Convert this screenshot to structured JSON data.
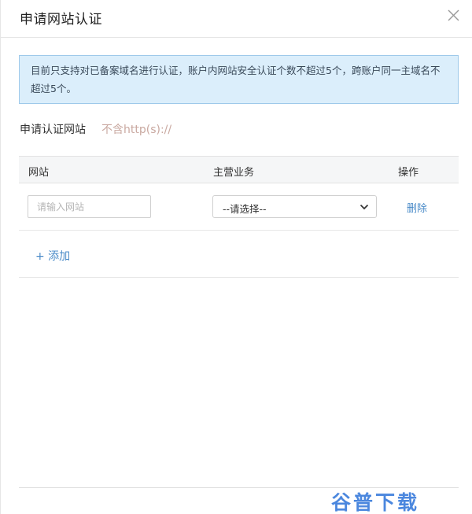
{
  "dialog": {
    "title": "申请网站认证",
    "notice": "目前只支持对已备案域名进行认证，账户内网站安全认证个数不超过5个，跨账户同一主域名不超过5个。"
  },
  "form": {
    "section_label": "申请认证网站",
    "section_hint": "不含http(s)://"
  },
  "table": {
    "headers": {
      "site": "网站",
      "business": "主营业务",
      "operation": "操作"
    },
    "rows": [
      {
        "site_value": "",
        "site_placeholder": "请输入网站",
        "business_selected": "--请选择--",
        "delete_label": "删除"
      }
    ]
  },
  "actions": {
    "add_label": "+ 添加"
  },
  "watermark": "谷普下载",
  "icons": {
    "close": "close-icon",
    "select_arrow": "chevron-down-icon"
  },
  "colors": {
    "notice_bg": "#dbeefb",
    "notice_border": "#9ec9ea",
    "link": "#4a8bc8",
    "hint": "#c9a8a0",
    "watermark": "#3c7ddc"
  }
}
